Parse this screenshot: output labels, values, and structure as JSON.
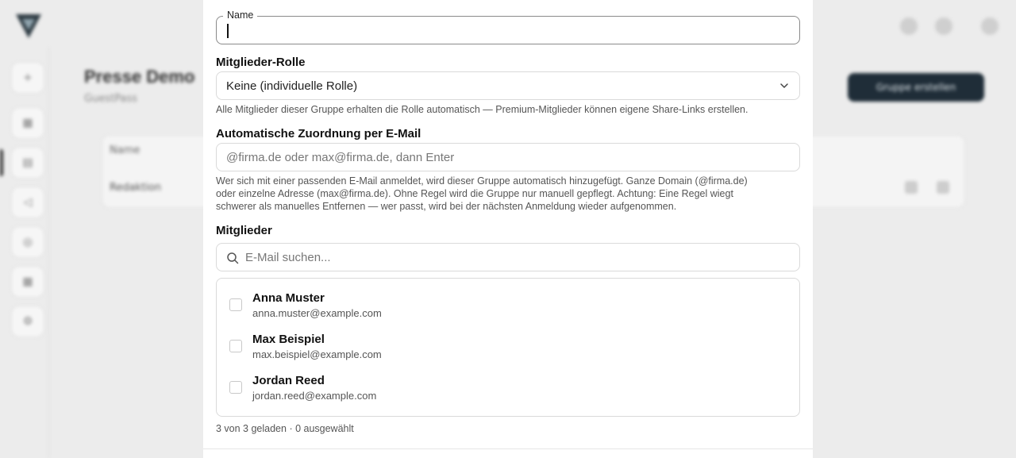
{
  "background": {
    "page_title": "Presse Demo",
    "page_subtitle": "GuestPass",
    "create_button": "Gruppe erstellen",
    "table_header_name": "Name",
    "table_row_name": "Redaktion"
  },
  "form": {
    "name_label": "Name",
    "name_value": "",
    "role_label": "Mitglieder-Rolle",
    "role_value": "Keine (individuelle Rolle)",
    "role_help": "Alle Mitglieder dieser Gruppe erhalten die Rolle automatisch — Premium-Mitglieder können eigene Share-Links erstellen.",
    "email_label": "Automatische Zuordnung per E-Mail",
    "email_placeholder": "@firma.de oder max@firma.de, dann Enter",
    "email_help_1": "Wer sich mit einer passenden E-Mail anmeldet, wird dieser Gruppe automatisch hinzugefügt. Ganze Domain (@firma.de)",
    "email_help_2": "oder einzelne Adresse (max@firma.de). Ohne Regel wird die Gruppe nur manuell gepflegt. Achtung: Eine Regel wiegt",
    "email_help_3": "schwerer als manuelles Entfernen — wer passt, wird bei der nächsten Anmeldung wieder aufgenommen.",
    "members_label": "Mitglieder",
    "search_placeholder": "E-Mail suchen...",
    "members": [
      {
        "name": "Anna Muster",
        "email": "anna.muster@example.com",
        "checked": false
      },
      {
        "name": "Max Beispiel",
        "email": "max.beispiel@example.com",
        "checked": false
      },
      {
        "name": "Jordan Reed",
        "email": "jordan.reed@example.com",
        "checked": false
      }
    ],
    "footer_count": "3 von 3 geladen · 0 ausgewählt"
  },
  "icons": {
    "search": "search-icon",
    "chevron": "chevron-down-icon"
  },
  "colors": {
    "accent_dark": "#1f2d38",
    "border": "#dadada"
  }
}
